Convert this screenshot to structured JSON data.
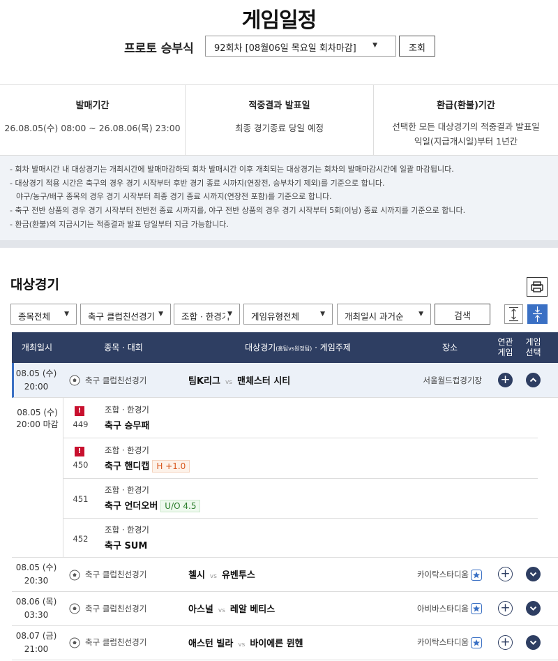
{
  "page": {
    "title": "게임일정"
  },
  "round_selector": {
    "label": "프로토 승부식",
    "selected": "92회차 [08월06일 목요일 회차마감]",
    "query_button": "조회"
  },
  "info": {
    "sale_period": {
      "title": "발매기간",
      "value": "26.08.05(수) 08:00 ~ 26.08.06(목) 23:00"
    },
    "result_date": {
      "title": "적중결과 발표일",
      "value": "최종 경기종료 당일 예정"
    },
    "refund_period": {
      "title": "환급(환불)기간",
      "value_line1": "선택한 모든 대상경기의 적중결과 발표일",
      "value_line2": "익일(지급개시일)부터 1년간"
    }
  },
  "notices": [
    "- 회차 발매시간 내 대상경기는 개최시간에 발매마감하되 회차 발매시간 이후 개최되는 대상경기는 회차의 발매마감시간에 일괄 마감됩니다.",
    "- 대상경기 적용 시간은 축구의 경우 경기 시작부터 후반 경기 종료 시까지(연장전, 승부차기 제외)를 기준으로 합니다.",
    "  야구/농구/배구 종목의 경우 경기 시작부터 최종 경기 종료 시까지(연장전 포함)를 기준으로 합니다.",
    "- 축구 전반 상품의 경우 경기 시작부터 전반전 종료 시까지를, 야구 전반 상품의 경우 경기 시작부터 5회(이닝) 종료 시까지를 기준으로 합니다.",
    "- 환급(환불)의 지급시기는 적중결과 발표 당일부터 지급 가능합니다."
  ],
  "section": {
    "title": "대상경기",
    "print_icon": "printer-icon"
  },
  "filters": {
    "sport": "종목전체",
    "competition": "축구 클럽친선경기",
    "game_category": "조합 · 한경기",
    "game_type": "게임유형전체",
    "sort": "개최일시 과거순",
    "search_button": "검색",
    "expand_icon": "expand-all-icon",
    "collapse_icon": "collapse-all-icon"
  },
  "table_header": {
    "date": "개최일시",
    "sport": "종목 · 대회",
    "matchup_main": "대상경기",
    "matchup_small": "(홈팀vs원정팀)",
    "matchup_tail": " · 게임주제",
    "venue": "장소",
    "related_1": "연관",
    "related_2": "게임",
    "select_1": "게임",
    "select_2": "선택"
  },
  "matches": [
    {
      "date": "08.05 (수)",
      "time": "20:00",
      "competition": "축구 클럽친선경기",
      "home": "팀K리그",
      "vs": "vs",
      "away": "맨체스터 시티",
      "venue": "서울월드컵경기장",
      "starred": false
    },
    {
      "date": "08.05 (수)",
      "time": "20:30",
      "competition": "축구 클럽친선경기",
      "home": "첼시",
      "vs": "vs",
      "away": "유벤투스",
      "venue": "카이탁스타디움",
      "starred": true
    },
    {
      "date": "08.06 (목)",
      "time": "03:30",
      "competition": "축구 클럽친선경기",
      "home": "아스널",
      "vs": "vs",
      "away": "레알 베티스",
      "venue": "아비바스타디움",
      "starred": true
    },
    {
      "date": "08.07 (금)",
      "time": "21:00",
      "competition": "축구 클럽친선경기",
      "home": "애스턴 빌라",
      "vs": "vs",
      "away": "바이에른 뮌헨",
      "venue": "카이탁스타디움",
      "starred": true
    }
  ],
  "expanded": {
    "date": "08.05 (수)",
    "time": "20:00 마감",
    "games": [
      {
        "num": "449",
        "type": "조합 · 한경기",
        "name": "축구 승무패",
        "badge": "",
        "warning": true
      },
      {
        "num": "450",
        "type": "조합 · 한경기",
        "name": "축구 핸디캡",
        "badge": "H +1.0",
        "warning": true
      },
      {
        "num": "451",
        "type": "조합 · 한경기",
        "name": "축구 언더오버",
        "badge": "U/O 4.5",
        "warning": false
      },
      {
        "num": "452",
        "type": "조합 · 한경기",
        "name": "축구 SUM",
        "badge": "",
        "warning": false
      }
    ]
  },
  "colors": {
    "header_bg": "#2e3e62",
    "accent": "#3a70c4",
    "warning": "#c8102e"
  }
}
